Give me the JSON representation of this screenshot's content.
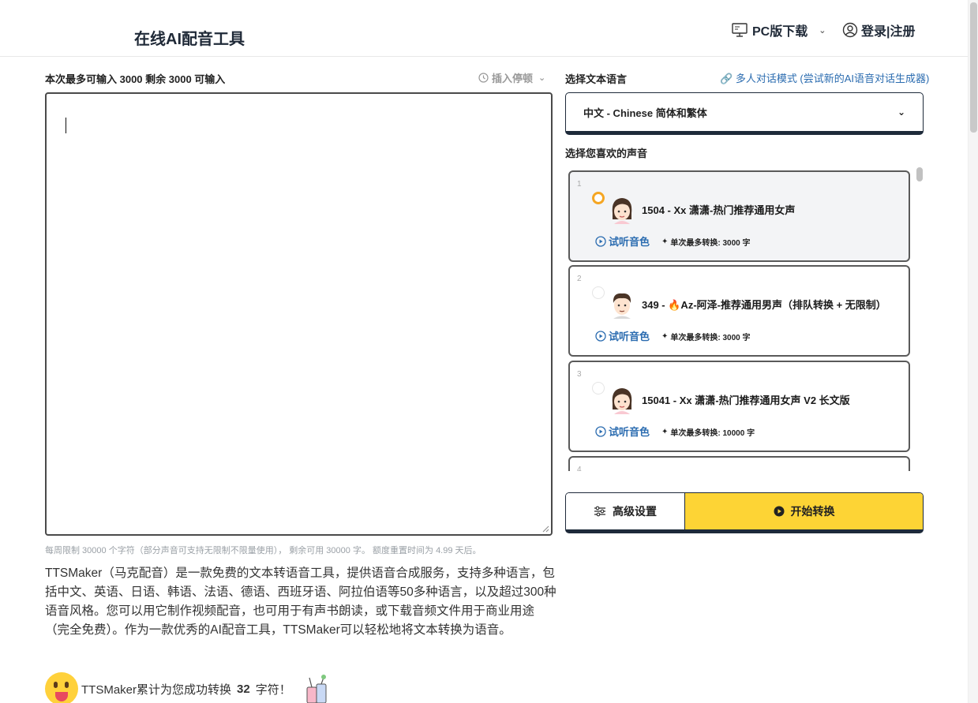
{
  "header": {
    "title": "在线AI配音工具",
    "pc_download": "PC版下载",
    "login": "登录|注册"
  },
  "editor": {
    "limit_text": "本次最多可输入 3000 剩余 3000 可输入",
    "insert_pause": "插入停顿",
    "text_value": "",
    "weekly_note": "每周限制 30000 个字符（部分声音可支持无限制不限量使用）， 剩余可用 30000 字。 额度重置时间为 4.99 天后。"
  },
  "description": "TTSMaker（马克配音）是一款免费的文本转语音工具，提供语音合成服务，支持多种语言，包括中文、英语、日语、韩语、法语、德语、西班牙语、阿拉伯语等50多种语言，以及超过300种语音风格。您可以用它制作视频配音，也可用于有声书朗读，或下载音频文件用于商业用途（完全免费）。作为一款优秀的AI配音工具，TTSMaker可以轻松地将文本转换为语音。",
  "counter": {
    "prefix": "TTSMaker累计为您成功转换",
    "count": "32",
    "suffix": "字符！"
  },
  "language": {
    "label": "选择文本语言",
    "multi_mode_link": "多人对话模式 (尝试新的AI语音对话生成器)",
    "selected": "中文 - Chinese 简体和繁体"
  },
  "voices": {
    "label": "选择您喜欢的声音",
    "preview_label": "试听音色",
    "items": [
      {
        "index": "1",
        "name": "1504 - Xx 潇潇-热门推荐通用女声",
        "max": "单次最多转换: 3000 字",
        "selected": true,
        "avatar": "female"
      },
      {
        "index": "2",
        "name": "349 - 🔥Az-阿泽-推荐通用男声（排队转换 + 无限制）",
        "max": "单次最多转换: 3000 字",
        "selected": false,
        "avatar": "male"
      },
      {
        "index": "3",
        "name": "15041 - Xx 潇潇-热门推荐通用女声 V2 长文版",
        "max": "单次最多转换: 10000 字",
        "selected": false,
        "avatar": "female"
      },
      {
        "index": "4",
        "name": "",
        "max": "",
        "selected": false,
        "avatar": "none"
      }
    ]
  },
  "actions": {
    "advanced": "高级设置",
    "start": "开始转换"
  },
  "colors": {
    "accent_yellow": "#fdd435",
    "link_blue": "#2b6cb0",
    "dark_border": "#1e2a3a",
    "radio_selected": "#f5a623"
  },
  "icons": {
    "pc_download": "monitor-icon",
    "login": "user-circle-icon",
    "insert_pause": "clock-icon",
    "multi_mode": "link-icon",
    "preview": "play-circle-icon",
    "max_conv": "sparkle-icon",
    "advanced": "sliders-icon",
    "start": "play-filled-icon"
  }
}
